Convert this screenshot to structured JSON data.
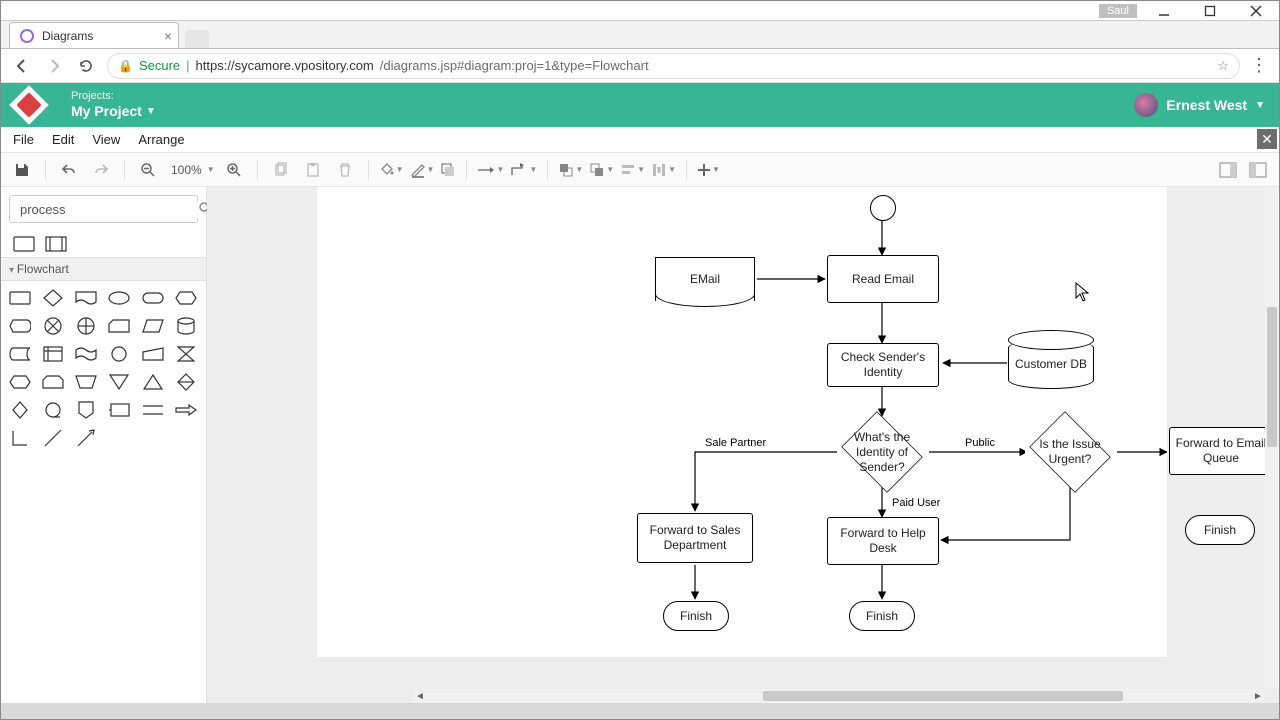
{
  "os": {
    "user": "Saul"
  },
  "browser": {
    "tab_title": "Diagrams",
    "url_secure_label": "Secure",
    "url_host": "https://sycamore.vpository.com",
    "url_path": "/diagrams.jsp#diagram:proj=1&type=Flowchart"
  },
  "header": {
    "projects_label": "Projects:",
    "project_name": "My Project",
    "user_name": "Ernest West"
  },
  "menubar": [
    "File",
    "Edit",
    "View",
    "Arrange"
  ],
  "toolbar": {
    "zoom": "100%"
  },
  "sidebar": {
    "search_value": "process",
    "section_label": "Flowchart"
  },
  "chart_data": {
    "type": "flowchart",
    "nodes": [
      {
        "id": "start",
        "shape": "start-circle",
        "label": ""
      },
      {
        "id": "email_doc",
        "shape": "document",
        "label": "EMail"
      },
      {
        "id": "read",
        "shape": "process",
        "label": "Read Email"
      },
      {
        "id": "check",
        "shape": "process",
        "label": "Check Sender's Identity"
      },
      {
        "id": "custdb",
        "shape": "database",
        "label": "Customer DB"
      },
      {
        "id": "identity",
        "shape": "decision",
        "label": "What's the Identity of Sender?"
      },
      {
        "id": "urgent",
        "shape": "decision",
        "label": "Is the Issue Urgent?"
      },
      {
        "id": "fsales",
        "shape": "process",
        "label": "Forward to Sales Department"
      },
      {
        "id": "fhelp",
        "shape": "process",
        "label": "Forward to Help Desk"
      },
      {
        "id": "fqueue",
        "shape": "process",
        "label": "Forward to Email Queue"
      },
      {
        "id": "finish1",
        "shape": "terminator",
        "label": "Finish"
      },
      {
        "id": "finish2",
        "shape": "terminator",
        "label": "Finish"
      },
      {
        "id": "finish3",
        "shape": "terminator",
        "label": "Finish"
      }
    ],
    "edges": [
      {
        "from": "start",
        "to": "read"
      },
      {
        "from": "email_doc",
        "to": "read"
      },
      {
        "from": "read",
        "to": "check"
      },
      {
        "from": "custdb",
        "to": "check"
      },
      {
        "from": "check",
        "to": "identity"
      },
      {
        "from": "identity",
        "to": "fsales",
        "label": "Sale Partner"
      },
      {
        "from": "identity",
        "to": "fhelp",
        "label": "Paid User"
      },
      {
        "from": "identity",
        "to": "urgent",
        "label": "Public"
      },
      {
        "from": "urgent",
        "to": "fqueue"
      },
      {
        "from": "urgent",
        "to": "fhelp"
      },
      {
        "from": "fsales",
        "to": "finish1"
      },
      {
        "from": "fhelp",
        "to": "finish2"
      },
      {
        "from": "fqueue",
        "to": "finish3"
      }
    ],
    "edge_labels": {
      "sale_partner": "Sale Partner",
      "paid_user": "Paid User",
      "public": "Public"
    }
  }
}
